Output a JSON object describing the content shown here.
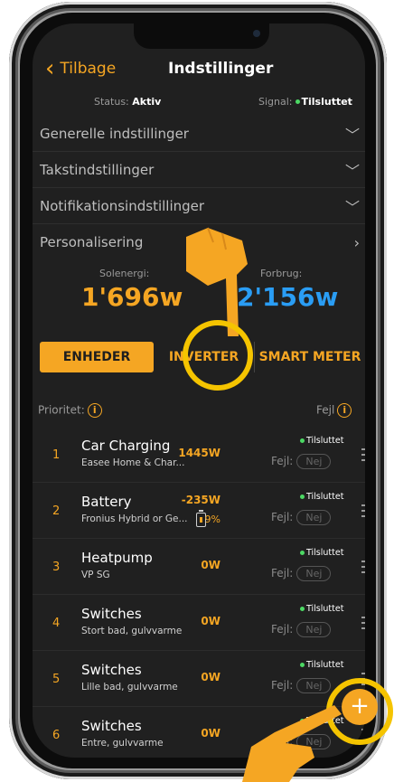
{
  "nav": {
    "back_label": "Tilbage",
    "title": "Indstillinger"
  },
  "status": {
    "status_label": "Status:",
    "status_value": "Aktiv",
    "signal_label": "Signal:",
    "signal_value": "Tilsluttet"
  },
  "settings": [
    {
      "label": "Generelle indstillinger",
      "chevron": "chevron-down-icon"
    },
    {
      "label": "Takstindstillinger",
      "chevron": "chevron-down-icon"
    },
    {
      "label": "Notifikationsindstillinger",
      "chevron": "chevron-down-icon"
    },
    {
      "label": "Personalisering",
      "chevron": "chevron-right-icon"
    }
  ],
  "energy": {
    "solar_label": "Solenergi:",
    "solar_value": "1'696w",
    "consumption_label": "Forbrug:",
    "consumption_value": "2'156w"
  },
  "tabs": {
    "t0": "ENHEDER",
    "t1": "INVERTER",
    "t2": "SMART METER"
  },
  "list_header": {
    "priority_label": "Prioritet:",
    "error_label": "Fejl"
  },
  "devices": [
    {
      "num": "1",
      "name": "Car Charging",
      "sub": "Easee Home & Char...",
      "power": "1445W",
      "status": "Tilsluttet",
      "fejl": "Fejl:",
      "nej": "Nej"
    },
    {
      "num": "2",
      "name": "Battery",
      "sub": "Fronius Hybrid or Ge...",
      "power": "-235W",
      "pct": "9%",
      "status": "Tilsluttet",
      "fejl": "Fejl:",
      "nej": "Nej"
    },
    {
      "num": "3",
      "name": "Heatpump",
      "sub": "VP SG",
      "power": "0W",
      "status": "Tilsluttet",
      "fejl": "Fejl:",
      "nej": "Nej"
    },
    {
      "num": "4",
      "name": "Switches",
      "sub": "Stort bad, gulvvarme",
      "power": "0W",
      "status": "Tilsluttet",
      "fejl": "Fejl:",
      "nej": "Nej"
    },
    {
      "num": "5",
      "name": "Switches",
      "sub": "Lille bad, gulvvarme",
      "power": "0W",
      "status": "Tilsluttet",
      "fejl": "Fejl:",
      "nej": "Nej"
    },
    {
      "num": "6",
      "name": "Switches",
      "sub": "Entre, gulvvarme",
      "power": "0W",
      "status": "Tilsluttet",
      "fejl": "Fejl:",
      "nej": "Nej"
    }
  ],
  "fab": {
    "icon": "plus-icon",
    "label": "+"
  },
  "colors": {
    "accent": "#f5a623",
    "blue": "#2a9df4",
    "bg": "#202020",
    "green": "#4cd964"
  }
}
